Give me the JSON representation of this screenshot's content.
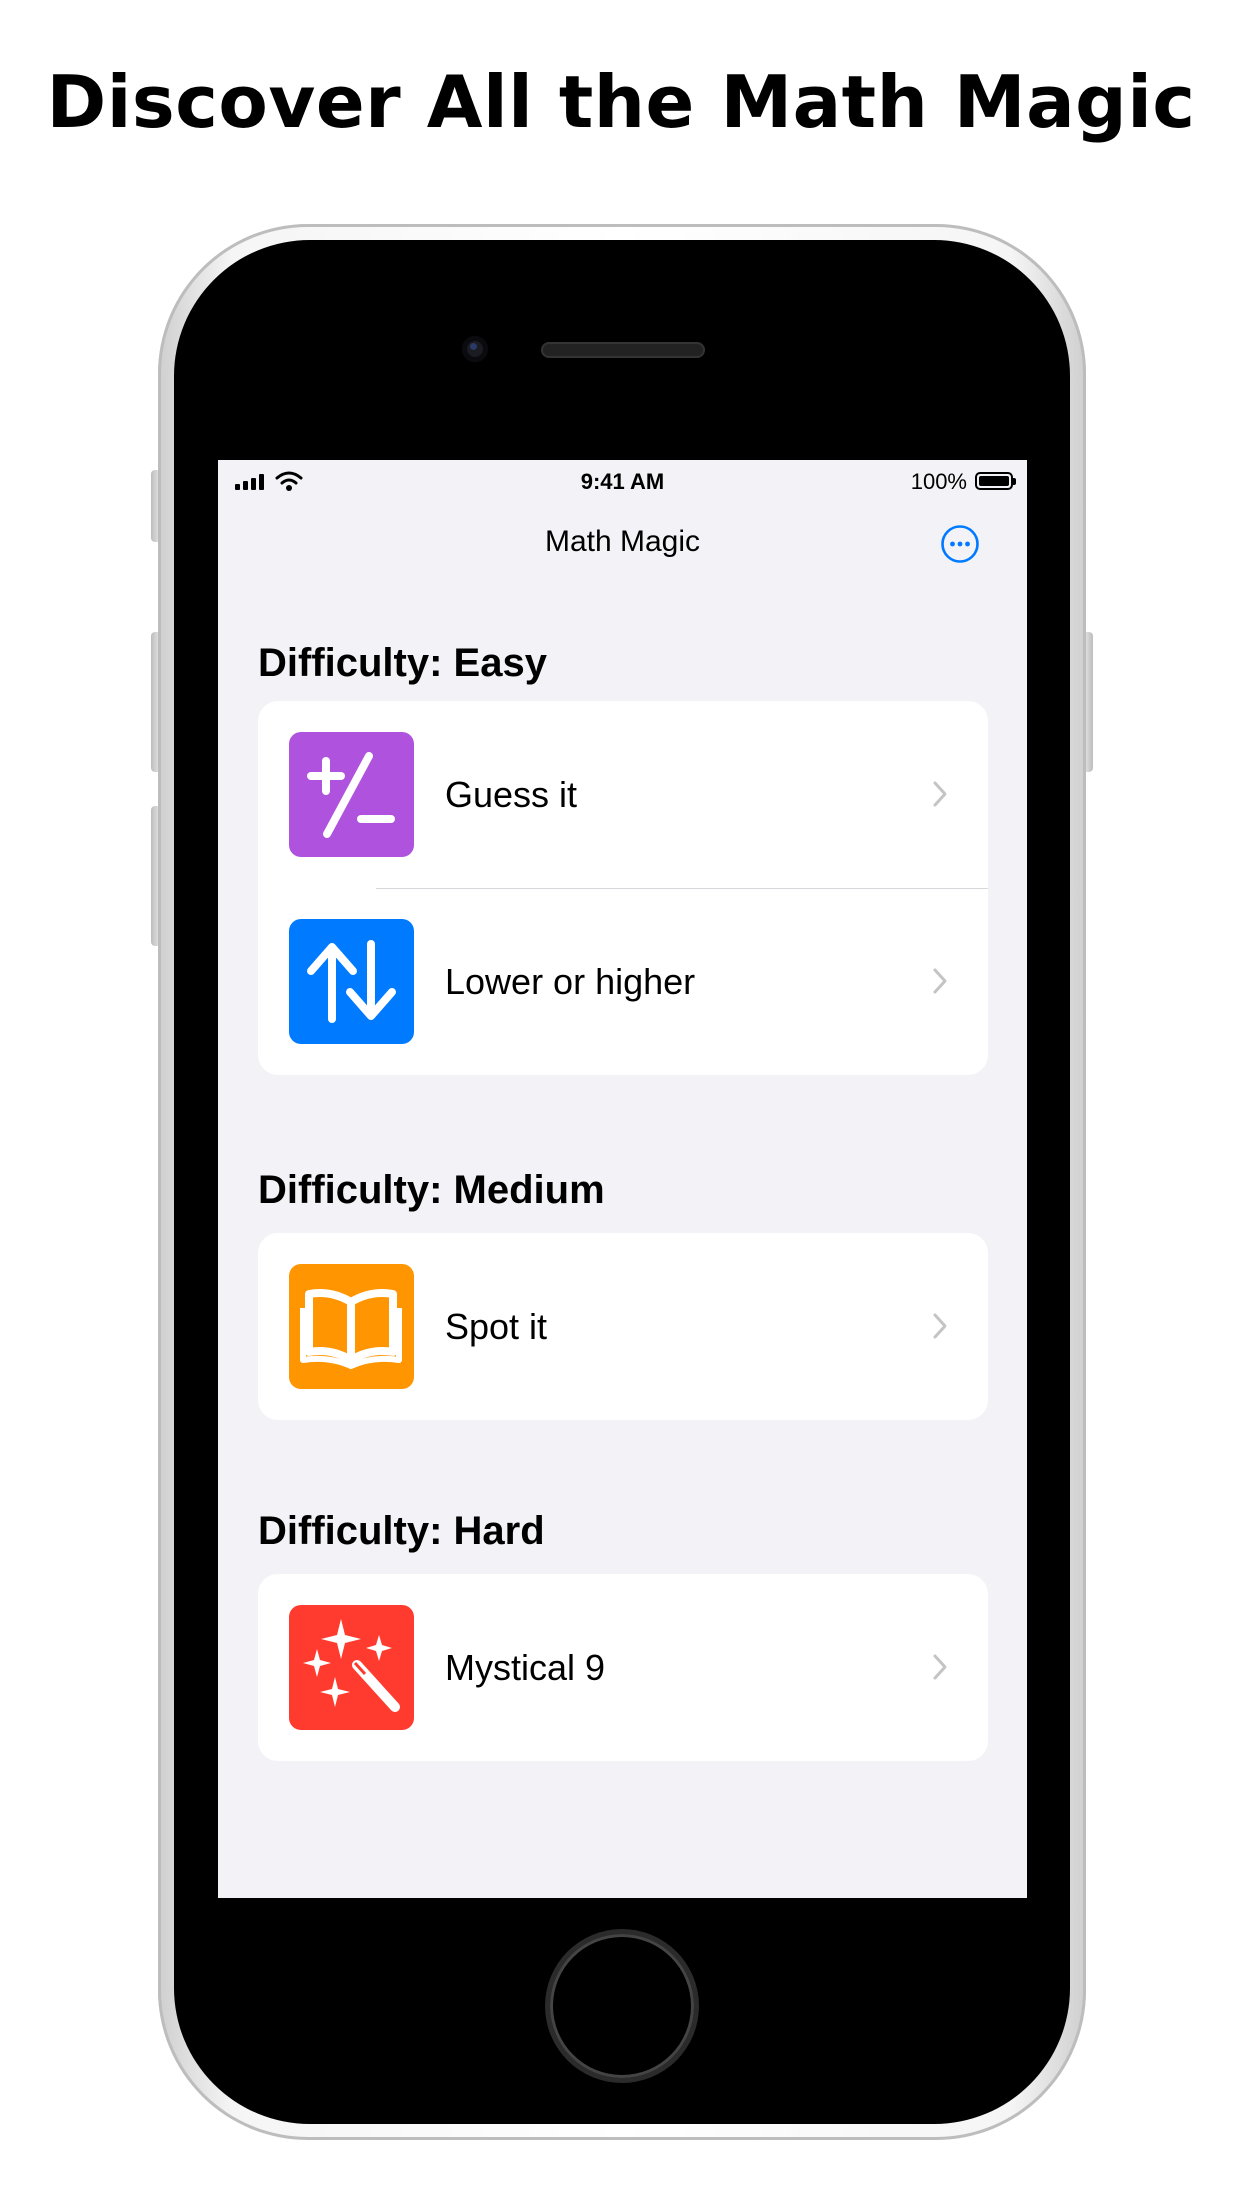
{
  "headline": "Discover All the Math Magic",
  "status_bar": {
    "time": "9:41 AM",
    "battery": "100%"
  },
  "nav": {
    "title": "Math Magic",
    "more_icon": "ellipsis-circle-icon"
  },
  "sections": [
    {
      "header": "Difficulty: Easy",
      "items": [
        {
          "label": "Guess it",
          "icon": "plus-slash-minus-icon",
          "color": "#AF52DE"
        },
        {
          "label": "Lower or higher",
          "icon": "arrow-up-arrow-down-icon",
          "color": "#007AFF"
        }
      ]
    },
    {
      "header": "Difficulty: Medium",
      "items": [
        {
          "label": "Spot it",
          "icon": "book-icon",
          "color": "#FF9500"
        }
      ]
    },
    {
      "header": "Difficulty: Hard",
      "items": [
        {
          "label": "Mystical 9",
          "icon": "magic-wand-sparkles-icon",
          "color": "#FF3B30"
        }
      ]
    }
  ],
  "colors": {
    "accent": "#007AFF",
    "background": "#F2F2F7"
  }
}
